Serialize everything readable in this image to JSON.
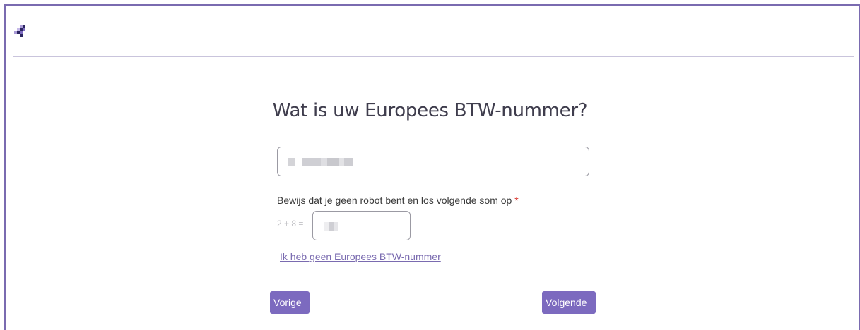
{
  "header": {
    "logo_icon": "pixel-cross-logo-icon"
  },
  "main": {
    "title": "Wat is uw Europees BTW-nummer?",
    "vat_input": {
      "value": "",
      "value_obscured": true
    },
    "captcha": {
      "label": "Bewijs dat je geen robot bent en los volgende som op",
      "required_marker": "*",
      "equation": "2 + 8 =",
      "value": "",
      "value_obscured": true
    },
    "no_vat_link": "Ik heb geen Europees BTW-nummer"
  },
  "footer_nav": {
    "prev_label": "Vorige",
    "next_label": "Volgende"
  },
  "colors": {
    "accent": "#7c6abf",
    "frame": "#7a6bb0",
    "required": "#d9342b",
    "logo_dark": "#2b2560",
    "logo_light": "#a99ad6"
  }
}
